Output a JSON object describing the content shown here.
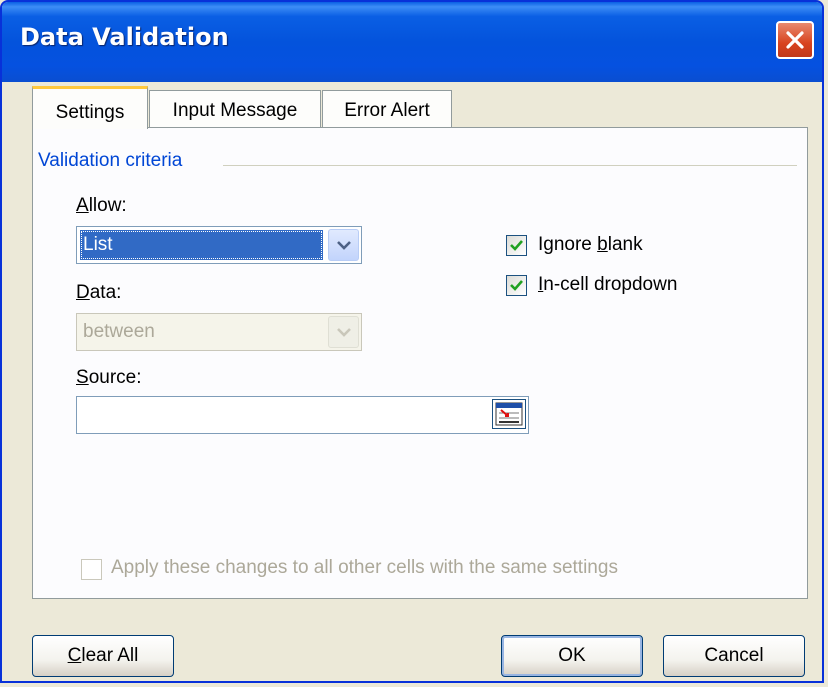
{
  "window": {
    "title": "Data Validation"
  },
  "tabs": [
    {
      "label": "Settings",
      "active": true
    },
    {
      "label": "Input Message",
      "active": false
    },
    {
      "label": "Error Alert",
      "active": false
    }
  ],
  "settings": {
    "group_label": "Validation criteria",
    "allow": {
      "label_prefix": "",
      "label_mnemonic": "A",
      "label_rest": "llow:",
      "value": "List"
    },
    "data": {
      "label_prefix": "",
      "label_mnemonic": "D",
      "label_rest": "ata:",
      "value": "between",
      "disabled": true
    },
    "source": {
      "label_prefix": "",
      "label_mnemonic": "S",
      "label_rest": "ource:",
      "value": ""
    },
    "ignore_blank": {
      "label_prefix": "Ignore ",
      "label_mnemonic": "b",
      "label_rest": "lank",
      "checked": true
    },
    "in_cell_dropdown": {
      "label_prefix": "",
      "label_mnemonic": "I",
      "label_rest": "n-cell dropdown",
      "checked": true
    },
    "apply_all": {
      "label": "Apply these changes to all other cells with the same settings",
      "checked": false,
      "disabled": true
    }
  },
  "buttons": {
    "clear_all": {
      "label_mnemonic": "C",
      "label_rest": "lear All"
    },
    "ok": "OK",
    "cancel": "Cancel"
  },
  "colors": {
    "titlebar": "#0453dc",
    "group_label": "#0046d5",
    "selection": "#316ac5",
    "check": "#21a121",
    "active_tab_accent": "#ffc83c"
  },
  "icons": {
    "close": "close-icon",
    "dropdown": "chevron-down-icon",
    "range_picker": "collapse-dialog-icon",
    "checkmark": "checkmark-icon"
  }
}
